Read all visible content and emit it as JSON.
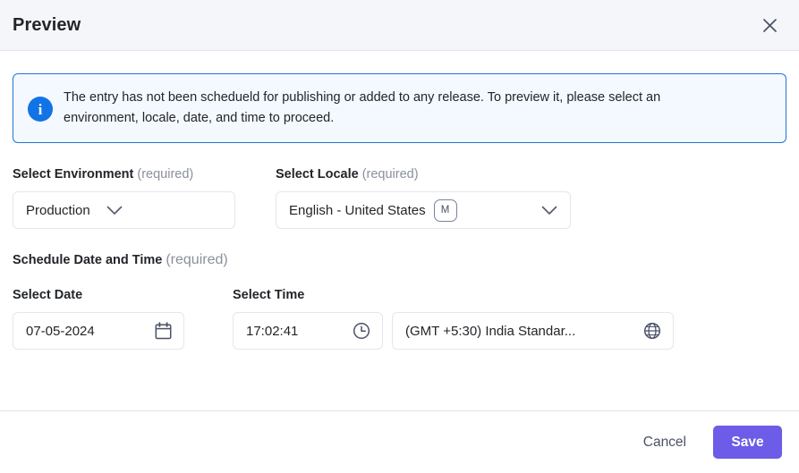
{
  "header": {
    "title": "Preview",
    "close_icon": "close-icon"
  },
  "banner": {
    "icon": "info-icon",
    "message": "The entry has not been schedueld for publishing or added to any release. To preview it, please select an environment, locale, date, and time to proceed.",
    "border_color": "#2075d6",
    "background_color": "#f4f9ff",
    "icon_color": "#1273e6"
  },
  "form": {
    "environment": {
      "label": "Select Environment",
      "required_text": "(required)",
      "value": "Production",
      "chevron_icon": "chevron-down-icon"
    },
    "locale": {
      "label": "Select Locale",
      "required_text": "(required)",
      "value": "English - United States",
      "badge": "M",
      "chevron_icon": "chevron-down-icon"
    },
    "schedule": {
      "label": "Schedule Date and Time",
      "required_text": "(required)"
    },
    "date": {
      "label": "Select Date",
      "value": "07-05-2024",
      "icon": "calendar-icon"
    },
    "time": {
      "label": "Select Time",
      "value": "17:02:41",
      "icon": "clock-icon"
    },
    "timezone": {
      "value": "(GMT +5:30) India Standar...",
      "icon": "globe-icon"
    }
  },
  "footer": {
    "cancel_label": "Cancel",
    "save_label": "Save",
    "save_color": "#6c5ce7"
  }
}
